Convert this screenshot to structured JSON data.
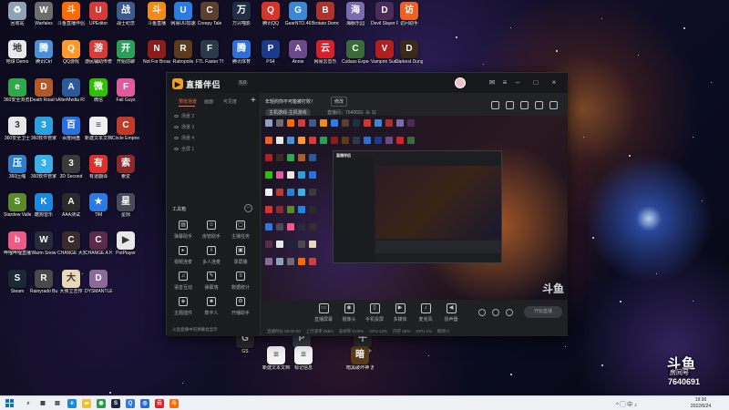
{
  "desktop": {
    "icons": [
      {
        "label": "回收站",
        "bg": "#8fa3b8",
        "glyph": "♻"
      },
      {
        "label": "Warfales",
        "bg": "#6d6d6d",
        "glyph": "W"
      },
      {
        "label": "斗鱼直播伴侣",
        "bg": "#ff6a00",
        "glyph": "斗"
      },
      {
        "label": "UPEditor",
        "bg": "#d53b3b",
        "glyph": "U"
      },
      {
        "label": "战士纪念",
        "bg": "#3c5a8a",
        "glyph": "战"
      },
      {
        "label": "斗鱼直播",
        "bg": "#f08a18",
        "glyph": "斗"
      },
      {
        "label": "网易UU加速",
        "bg": "#2a7de1",
        "glyph": "U"
      },
      {
        "label": "Creepy Tale",
        "bg": "#5a4030",
        "glyph": "C"
      },
      {
        "label": "万兴喵影",
        "bg": "#1f2f45",
        "glyph": "万"
      },
      {
        "label": "腾讯QQ",
        "bg": "#d9342b",
        "glyph": "Q"
      },
      {
        "label": "GearNTO.46",
        "bg": "#3a87d6",
        "glyph": "G"
      },
      {
        "label": "Brotato Demo",
        "bg": "#b0302b",
        "glyph": "B"
      },
      {
        "label": "海豚乐园",
        "bg": "#7a6bb0",
        "glyph": "海"
      },
      {
        "label": "Devil Slayer Raksasi",
        "bg": "#4a2b5a",
        "glyph": "D"
      },
      {
        "label": "访问助手",
        "bg": "#f06020",
        "glyph": "访"
      },
      {
        "label": "地球 Demo",
        "bg": "#e8e8e8",
        "glyph": "地"
      },
      {
        "label": "腾讯Ctrl",
        "bg": "#4a90d9",
        "glyph": "腾"
      },
      {
        "label": "QQ游戏",
        "bg": "#ff9a2a",
        "glyph": "Q"
      },
      {
        "label": "游民辅助传奇",
        "bg": "#d83a3a",
        "glyph": "游"
      },
      {
        "label": "开始前聊",
        "bg": "#2b9e5a",
        "glyph": "开"
      },
      {
        "label": "Not For Broadcast",
        "bg": "#8b1c1c",
        "glyph": "N"
      },
      {
        "label": "Ratropolis",
        "bg": "#5b3a1e",
        "glyph": "R"
      },
      {
        "label": "FTL Faster Than Light",
        "bg": "#2a3a4a",
        "glyph": "F"
      },
      {
        "label": "腾讯体育",
        "bg": "#2e6fd8",
        "glyph": "腾"
      },
      {
        "label": "PS4",
        "bg": "#1b3a8a",
        "glyph": "P"
      },
      {
        "label": "Annie",
        "bg": "#6a4a8a",
        "glyph": "A"
      },
      {
        "label": "网易云音乐",
        "bg": "#d8202a",
        "glyph": "云"
      },
      {
        "label": "Cutlass Expedition",
        "bg": "#3a6a3a",
        "glyph": "C"
      },
      {
        "label": "Vampire Survivors",
        "bg": "#b02020",
        "glyph": "V"
      },
      {
        "label": "Darkest Dungeon",
        "bg": "#3a2a1a",
        "glyph": "D"
      },
      {
        "label": "360安全浏览器",
        "bg": "#2ea84a",
        "glyph": "e"
      },
      {
        "label": "Death Road to Canada",
        "bg": "#b05a2a",
        "glyph": "D"
      },
      {
        "label": "AlterMedia RSCentral",
        "bg": "#2a5a9a",
        "glyph": "A"
      },
      {
        "label": "微信",
        "bg": "#2dc100",
        "glyph": "微"
      },
      {
        "label": "Fall Guys",
        "bg": "#e05aa0",
        "glyph": "F"
      },
      {
        "label": "360安全卫士",
        "bg": "#e8e8e8",
        "glyph": "3"
      },
      {
        "label": "360软件管家",
        "bg": "#2aa0e0",
        "glyph": "3"
      },
      {
        "label": "百度网盘",
        "bg": "#2a70e0",
        "glyph": "百"
      },
      {
        "label": "新建文本文档",
        "bg": "#f0f0f0",
        "glyph": "≡"
      },
      {
        "label": "Circle Empire",
        "bg": "#c03a2a",
        "glyph": "C"
      },
      {
        "label": "360压缩",
        "bg": "#2a80d0",
        "glyph": "压"
      },
      {
        "label": "360软件管家",
        "bg": "#3ab0e8",
        "glyph": "3"
      },
      {
        "label": "3D Second",
        "bg": "#3a3a3a",
        "glyph": "3"
      },
      {
        "label": "有道翻译",
        "bg": "#e0302a",
        "glyph": "有"
      },
      {
        "label": "索爱",
        "bg": "#8a2a2a",
        "glyph": "索"
      },
      {
        "label": "Stardew Valley",
        "bg": "#5a8a2a",
        "glyph": "S"
      },
      {
        "label": "酷狗音乐",
        "bg": "#1a8ae0",
        "glyph": "K"
      },
      {
        "label": "AAA测试",
        "bg": "#2a2a2a",
        "glyph": "A"
      },
      {
        "label": "TIM",
        "bg": "#2a7ae0",
        "glyph": "★"
      },
      {
        "label": "星际",
        "bg": "#4a4a5a",
        "glyph": "星"
      },
      {
        "label": "哔哩哔哩直播姬",
        "bg": "#f05a8a",
        "glyph": "b"
      },
      {
        "label": "Warm Snow",
        "bg": "#2a2a3a",
        "glyph": "W"
      },
      {
        "label": "CHANGE 大家玩的游戏",
        "bg": "#3a2a2a",
        "glyph": "C"
      },
      {
        "label": "CHANGE A Homeless",
        "bg": "#5a2a4a",
        "glyph": "C"
      },
      {
        "label": "PotPlayer",
        "bg": "#e8e8e8",
        "glyph": "▶"
      },
      {
        "label": "Steam",
        "bg": "#1b2838",
        "glyph": "S"
      },
      {
        "label": "Rainyrado Bumpcam",
        "bg": "#4a4a4a",
        "glyph": "R"
      },
      {
        "label": "大侠立志传",
        "bg": "#e8d8b8",
        "glyph": "大"
      },
      {
        "label": "DYSMANTLE",
        "bg": "#8a6a9a",
        "glyph": "D"
      }
    ],
    "bottom_icons": [
      {
        "label": "GS",
        "bg": "#2a2a2a",
        "glyph": "G"
      },
      {
        "label": "Prism",
        "bg": "#3a3a4a",
        "glyph": "P"
      },
      {
        "label": "新建文本文档",
        "bg": "#f4f4f4",
        "glyph": "≡"
      },
      {
        "label": "标记信息",
        "bg": "#f4f4f4",
        "glyph": "≡"
      },
      {
        "label": "午夜猎手",
        "bg": "#2a2a2a",
        "glyph": "午"
      },
      {
        "label": "暗黑破坏神 游戏相关",
        "bg": "#5a3a1a",
        "glyph": "暗"
      }
    ]
  },
  "app": {
    "title": "直播伴侣",
    "version": "5.0",
    "left_tabs": [
      "预览场景",
      "画面",
      "可见度"
    ],
    "scenes": [
      "场景 2",
      "场景 3",
      "场景 4",
      "全屏 1"
    ],
    "toolbox_title": "工具箱",
    "tools": [
      "弹幕助手",
      "房管助手",
      "主播任务",
      "视频连麦",
      "多人连麦",
      "录屏播",
      "语音互动",
      "弹幕墙",
      "数据统计",
      "主题插件",
      "数字人",
      "开播助手"
    ],
    "room_title": "年轻的你不可能被打败！",
    "edit_title": "修改",
    "category": "主机游戏-主机游戏",
    "room_line": "直播间：7640691",
    "online": "11",
    "bottom_buttons": [
      "直播屏幕",
      "摄像头",
      "手机投屏",
      "多媒体",
      "麦克风",
      "扬声器"
    ],
    "start_live": "开始直播",
    "status": [
      "直播时长 00:00:00",
      "上行速率 0kb/s",
      "丢帧率 0.00%",
      "CPU 12%",
      "内存 26%",
      "GPU 1%",
      "断网 0"
    ],
    "danmu_line": "斗鱼直播中的弹幕会显示"
  },
  "watermark": {
    "logo": "斗鱼",
    "room_label": "房间号",
    "room_number": "7640691"
  },
  "taskbar": {
    "apps": [
      {
        "glyph": "⌕",
        "bg": "#eef0f4",
        "fg": "#333"
      },
      {
        "glyph": "▦",
        "bg": "#eef0f4",
        "fg": "#333"
      },
      {
        "glyph": "▤",
        "bg": "#eef0f4",
        "fg": "#333"
      },
      {
        "glyph": "e",
        "bg": "#1a8ae0",
        "fg": "#fff"
      },
      {
        "glyph": "▰",
        "bg": "#f0c030",
        "fg": "#fff"
      },
      {
        "glyph": "◉",
        "bg": "#2a9a4a",
        "fg": "#fff"
      },
      {
        "glyph": "S",
        "bg": "#1b2838",
        "fg": "#fff"
      },
      {
        "glyph": "Q",
        "bg": "#2a7ae0",
        "fg": "#fff"
      },
      {
        "glyph": "◎",
        "bg": "#2a6ad0",
        "fg": "#fff"
      },
      {
        "glyph": "云",
        "bg": "#d8202a",
        "fg": "#fff"
      },
      {
        "glyph": "斗",
        "bg": "#ff6a00",
        "fg": "#fff"
      }
    ],
    "tray": "^ ▢ 中 ♪",
    "time": "19:36",
    "date": "2022/6/24"
  }
}
